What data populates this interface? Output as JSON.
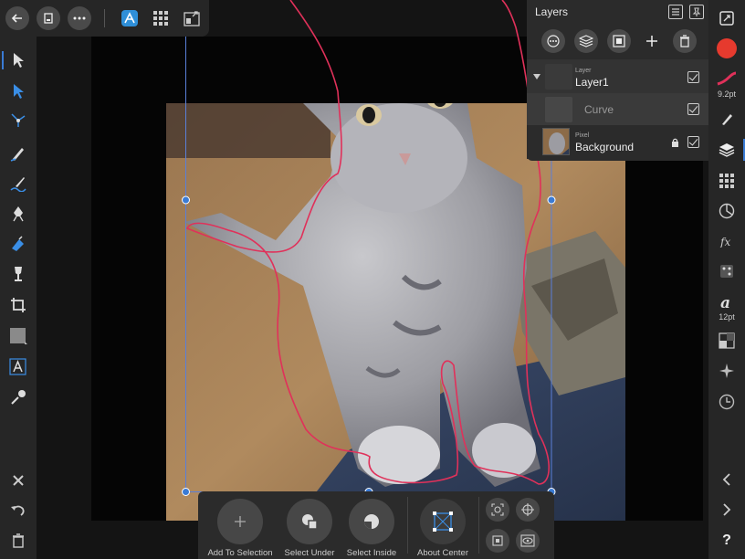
{
  "layers_panel": {
    "title": "Layers",
    "rows": [
      {
        "kind": "Layer",
        "name": "Layer1"
      },
      {
        "kind": "",
        "name": "Curve"
      },
      {
        "kind": "Pixel",
        "name": "Background"
      }
    ]
  },
  "right_bar": {
    "brush_size": "9.2pt",
    "font_size": "12pt",
    "help": "?"
  },
  "context_toolbar": {
    "add_to_selection": "Add To Selection",
    "select_under": "Select Under",
    "select_inside": "Select Inside",
    "about_center": "About Center"
  },
  "colors": {
    "accent": "#3a8ee6",
    "primary_color": "#e63a2e",
    "selection_outline": "#e0315a",
    "bbox": "#5a7fd8"
  },
  "icons": {
    "top": [
      "back-icon",
      "document-icon",
      "more-icon",
      "designer-persona-icon",
      "pixel-persona-icon",
      "export-persona-icon"
    ]
  }
}
